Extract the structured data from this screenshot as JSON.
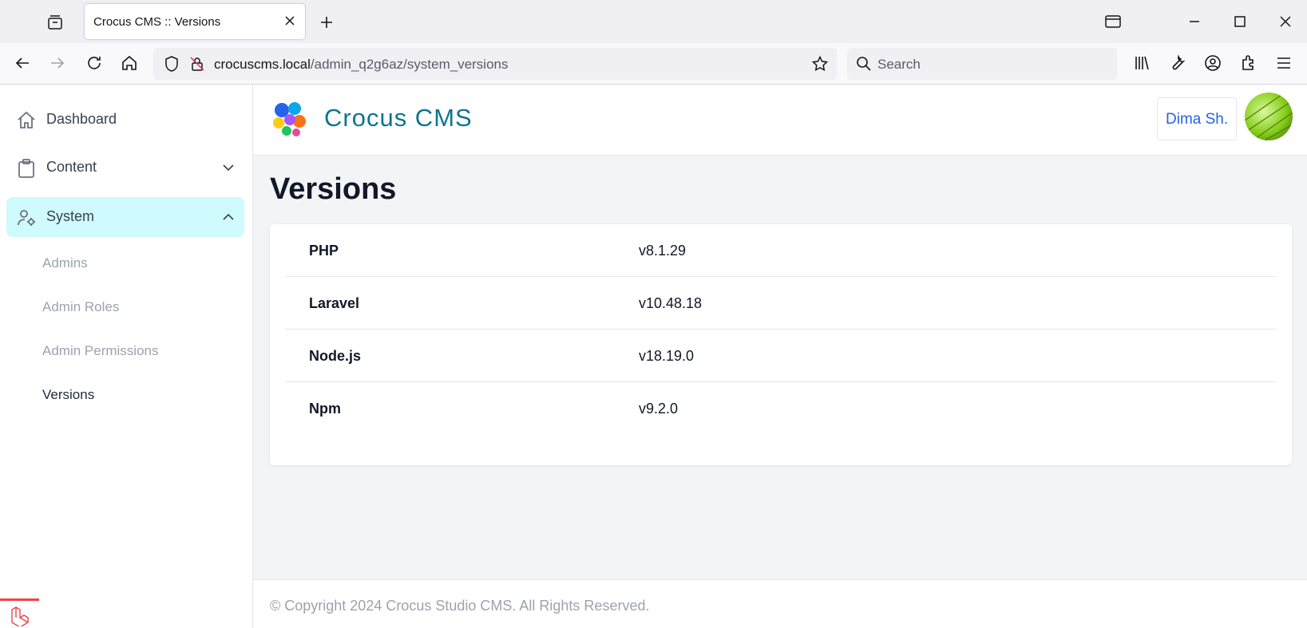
{
  "browser": {
    "tab_title": "Crocus CMS :: Versions",
    "url_host": "crocuscms.local",
    "url_path": "/admin_q2g6az/system_versions",
    "search_placeholder": "Search"
  },
  "app": {
    "brand": "Crocus CMS",
    "user_name": "Dima Sh.",
    "accent_color": "#0e7490",
    "active_bg": "#cffafe"
  },
  "sidebar": {
    "items": [
      {
        "label": "Dashboard",
        "icon": "home-icon"
      },
      {
        "label": "Content",
        "icon": "clipboard-icon"
      },
      {
        "label": "System",
        "icon": "user-cog-icon"
      }
    ],
    "system_children": [
      "Admins",
      "Admin Roles",
      "Admin Permissions",
      "Versions"
    ]
  },
  "page": {
    "title": "Versions",
    "versions": [
      {
        "name": "PHP",
        "version": "v8.1.29"
      },
      {
        "name": "Laravel",
        "version": "v10.48.18"
      },
      {
        "name": "Node.js",
        "version": "v18.19.0"
      },
      {
        "name": "Npm",
        "version": "v9.2.0"
      }
    ]
  },
  "footer": {
    "copyright": "© Copyright 2024 Crocus Studio CMS. All Rights Reserved."
  }
}
